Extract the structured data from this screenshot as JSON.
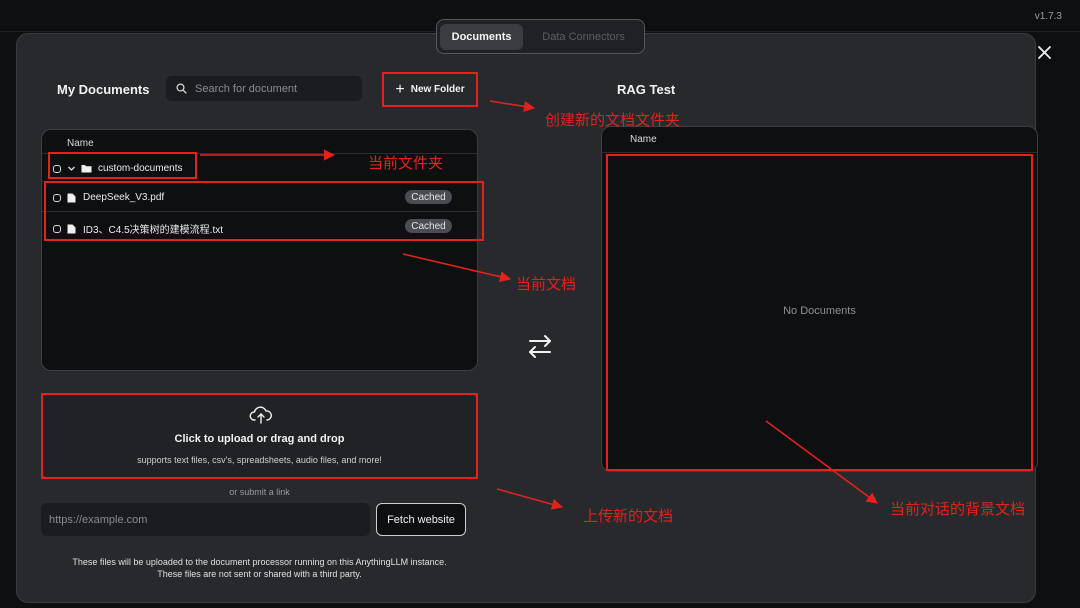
{
  "version": "v1.7.3",
  "tabs": {
    "documents": "Documents",
    "data_connectors": "Data Connectors"
  },
  "left": {
    "title": "My Documents",
    "search_placeholder": "Search for document",
    "new_folder": "New Folder",
    "column_name": "Name",
    "folder": {
      "name": "custom-documents"
    },
    "files": [
      {
        "name": "DeepSeek_V3.pdf",
        "badge": "Cached"
      },
      {
        "name": "ID3、C4.5决策树的建模流程.txt",
        "badge": "Cached"
      }
    ]
  },
  "upload": {
    "title": "Click to upload or drag and drop",
    "subtitle": "supports text files, csv's, spreadsheets, audio files, and more!",
    "or_link": "or submit a link",
    "url_placeholder": "https://example.com",
    "fetch_button": "Fetch website"
  },
  "footer": {
    "line1": "These files will be uploaded to the document processor running on this AnythingLLM instance.",
    "line2": "These files are not sent or shared with a third party."
  },
  "right": {
    "title": "RAG Test",
    "column_name": "Name",
    "empty": "No Documents"
  },
  "annotations": {
    "new_folder": "创建新的文档文件夹",
    "current_folder": "当前文件夹",
    "current_docs": "当前文档",
    "upload_docs": "上传新的文档",
    "background_docs": "当前对话的背景文档"
  },
  "colors": {
    "annotation": "#e3221c",
    "modal": "#27292d",
    "panel": "#0e0f11"
  },
  "icons": [
    "search-icon",
    "plus-icon",
    "close-icon",
    "folder-icon",
    "file-icon",
    "chevron-down-icon",
    "cloud-upload-icon",
    "swap-arrows-icon"
  ]
}
